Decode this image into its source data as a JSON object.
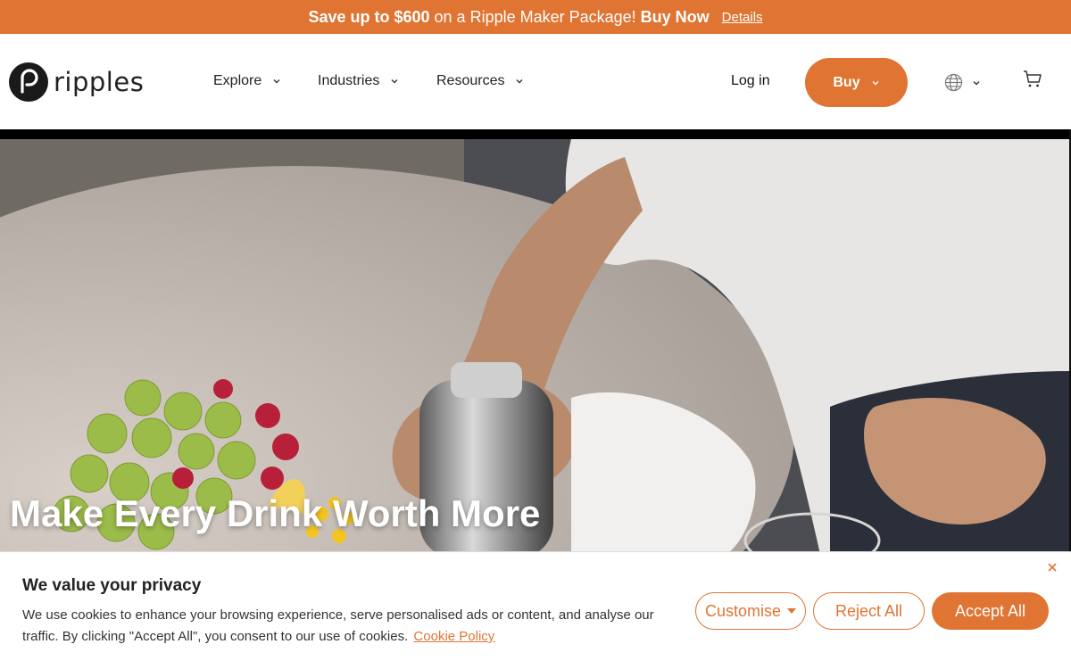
{
  "promo": {
    "part1": "Save up to $600",
    "part2": "on a Ripple Maker Package!",
    "part3": "Buy Now",
    "details": "Details"
  },
  "header": {
    "logo_text": "ripples",
    "nav": [
      {
        "label": "Explore"
      },
      {
        "label": "Industries"
      },
      {
        "label": "Resources"
      }
    ],
    "login": "Log in",
    "buy": "Buy"
  },
  "hero": {
    "title": "Make Every Drink Worth More"
  },
  "cookie": {
    "title": "We value your privacy",
    "text": "We use cookies to enhance your browsing experience, serve personalised ads or content, and analyse our traffic. By clicking \"Accept All\", you consent to our use of cookies.",
    "policy_link": "Cookie Policy",
    "customise": "Customise",
    "reject": "Reject All",
    "accept": "Accept All"
  },
  "colors": {
    "accent": "#e07432"
  },
  "icons": [
    "ripples-logo-icon",
    "chevron-down-icon",
    "globe-icon",
    "cart-icon",
    "close-icon",
    "caret-down-icon"
  ]
}
